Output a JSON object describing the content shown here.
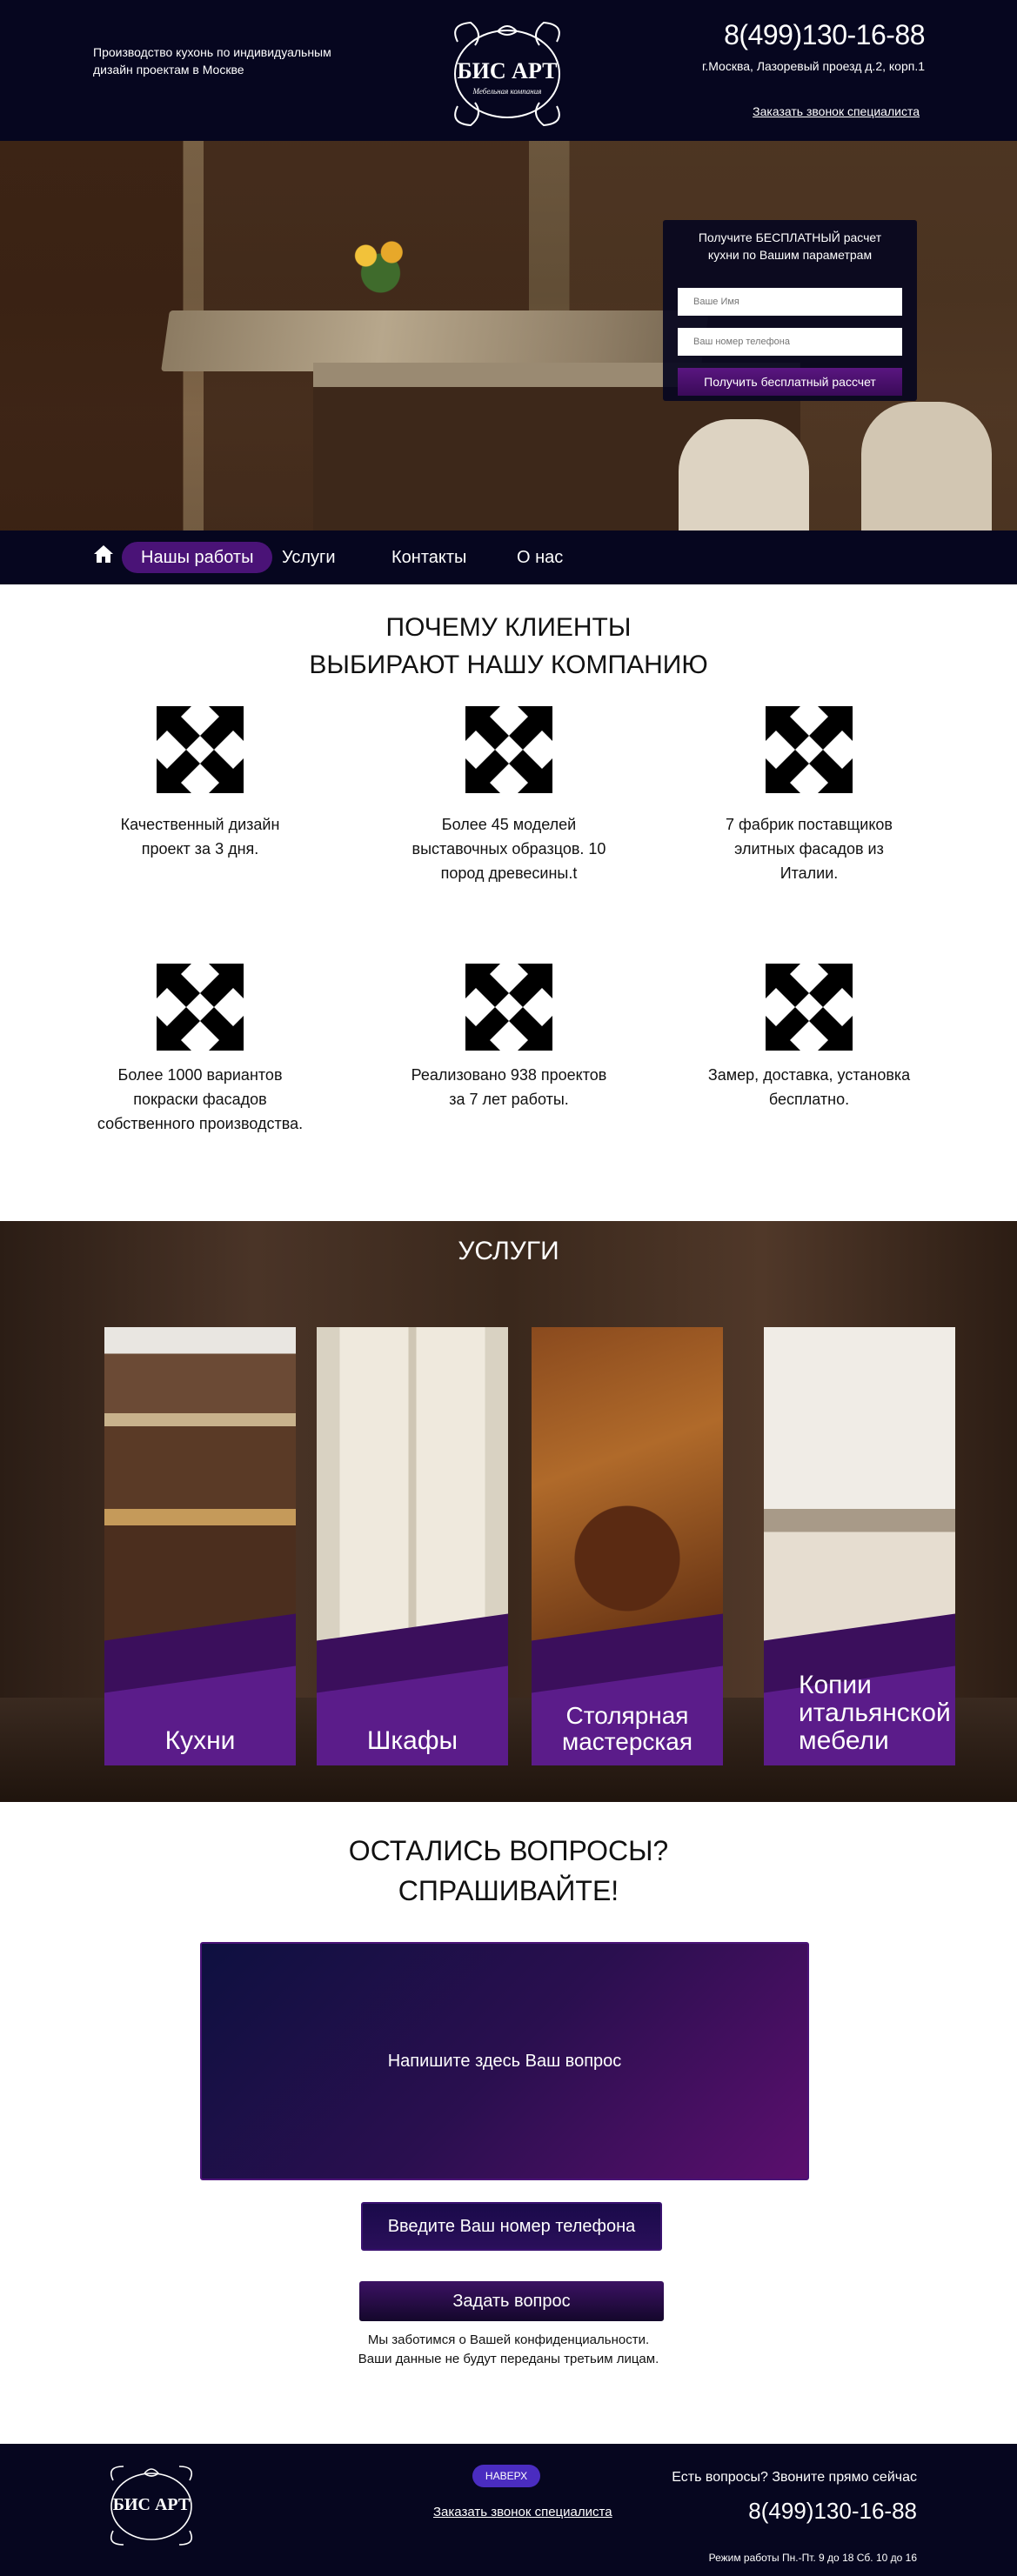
{
  "header": {
    "tagline": "Производство кухонь по индивидуальным дизайн проектам в Москве",
    "logo_text": "БИС АРТ",
    "logo_subtext": "Мебельная компания",
    "phone": "8(499)130-16-88",
    "address": "г.Москва, Лазоревый проезд д.2, корп.1",
    "callback_link": "Заказать звонок специалиста"
  },
  "hero_form": {
    "title_line1": "Получите БЕСПЛАТНЫЙ расчет",
    "title_line2": "кухни по Вашим параметрам",
    "name_placeholder": "Ваше Имя",
    "phone_placeholder": "Ваш номер телефона",
    "submit_label": "Получить бесплатный рассчет"
  },
  "nav": {
    "home_icon": "home-icon",
    "items": [
      {
        "label": "Нашы работы",
        "active": true
      },
      {
        "label": "Услуги",
        "active": false
      },
      {
        "label": "Контакты",
        "active": false
      },
      {
        "label": "О нас",
        "active": false
      }
    ]
  },
  "why": {
    "title_line1": "ПОЧЕМУ КЛИЕНТЫ",
    "title_line2": "ВЫБИРАЮТ НАШУ КОМПАНИЮ",
    "feature_icon": "expand-arrows-icon",
    "features": [
      {
        "text": "Качественный дизайн проект за 3 дня."
      },
      {
        "text": "Более 45 моделей выставочных образцов. 10 пород древесины.t"
      },
      {
        "text": "7 фабрик поставщиков элитных фасадов из Италии."
      },
      {
        "text": "Более 1000 вариантов покраски фасадов собственного производства."
      },
      {
        "text": "Реализовано 938 проектов за 7 лет работы."
      },
      {
        "text": "Замер, доставка, установка бесплатно."
      }
    ]
  },
  "services": {
    "title": "УСЛУГИ",
    "cards": [
      {
        "label": "Кухни"
      },
      {
        "label": "Шкафы"
      },
      {
        "label": "Столярная мастерская"
      },
      {
        "label": "Копии итальянской мебели"
      }
    ]
  },
  "questions": {
    "title_line1": "ОСТАЛИСЬ ВОПРОСЫ?",
    "title_line2": "СПРАШИВАЙТЕ!",
    "textarea_placeholder": "Напишите здесь Ваш вопрос",
    "phone_placeholder": "Введите Ваш номер телефона",
    "submit_label": "Задать вопрос",
    "privacy_line1": "Мы заботимся о Вашей конфиденциальности.",
    "privacy_line2": "Ваши данные не будут переданы третьим лицам."
  },
  "footer": {
    "logo_text": "БИС АРТ",
    "up_label": "НАВЕРХ",
    "callback_link": "Заказать звонок специалиста",
    "question_text": "Есть вопросы? Звоните прямо сейчас",
    "phone": "8(499)130-16-88",
    "hours": "Режим работы Пн.-Пт. 9 до 18 Сб. 10 до 16"
  },
  "colors": {
    "header_bg": "#06061f",
    "accent_purple": "#4a1377",
    "card_purple": "#5b1c8a"
  }
}
